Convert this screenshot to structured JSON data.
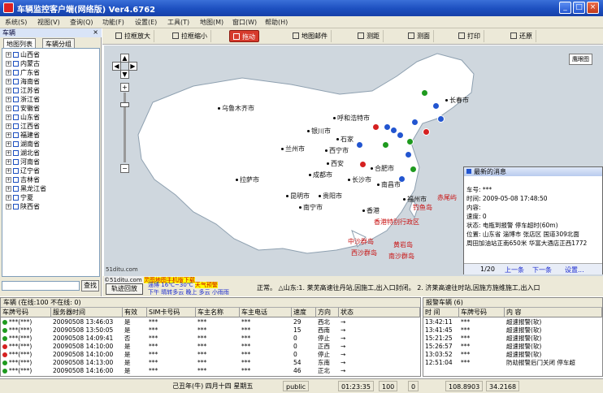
{
  "window": {
    "title": "车辆监控客户端(网络版) Ver4.6762",
    "minimize": "_",
    "maximize": "□",
    "close": "×"
  },
  "menu": [
    "系统(S)",
    "视图(V)",
    "查询(Q)",
    "功能(F)",
    "设置(E)",
    "工具(T)",
    "地图(M)",
    "窗口(W)",
    "帮助(H)"
  ],
  "left_panel": {
    "title": "车辆",
    "close": "×",
    "tabs": [
      "地图列表",
      "车辆分组"
    ],
    "provinces": [
      "山西省",
      "内蒙古",
      "广东省",
      "海南省",
      "江苏省",
      "浙江省",
      "安徽省",
      "山东省",
      "江西省",
      "福建省",
      "湖南省",
      "湖北省",
      "河南省",
      "辽宁省",
      "吉林省",
      "黑龙江省",
      "宁夏",
      "陕西省"
    ],
    "search_button": "查找"
  },
  "toolbar": {
    "zoom_in": "拉框放大",
    "zoom_out": "拉框缩小",
    "pan": "拖动",
    "map_info": "地图邮件",
    "distance": "测距",
    "area": "测面",
    "print": "打印",
    "restore": "还原"
  },
  "map": {
    "eagle_eye": "鹰眼图",
    "scale": "51ditu.com",
    "cities": [
      {
        "name": "乌鲁木齐市"
      },
      {
        "name": "呼和浩特市"
      },
      {
        "name": "银川市"
      },
      {
        "name": "兰州市"
      },
      {
        "name": "西宁市"
      },
      {
        "name": "拉萨市"
      },
      {
        "name": "成都市"
      },
      {
        "name": "昆明市"
      },
      {
        "name": "贵阳市"
      },
      {
        "name": "南宁市"
      },
      {
        "name": "长沙市"
      },
      {
        "name": "合肥市"
      },
      {
        "name": "南昌市"
      },
      {
        "name": "香港"
      },
      {
        "name": "福州市"
      },
      {
        "name": "石家"
      },
      {
        "name": "长春市"
      },
      {
        "name": "西安"
      }
    ],
    "red_labels": [
      "赤尾屿",
      "钓鱼岛",
      "中沙群岛",
      "西沙群岛",
      "黄岩岛",
      "南沙群岛",
      "香港特别行政区"
    ],
    "message": {
      "title": "最新的消息",
      "lines": [
        "车号: ***",
        "时间: 2009-05-08 17:48:50",
        "内容:",
        "速度: 0",
        "状态: 电瓶到报警 停车超时(60m)",
        "位置: 山东省 淄博市 张店区 国道309北面",
        "周田加油站正南650米 华富大酒店正西1772"
      ],
      "page": "1/20",
      "prev": "上一条",
      "next": "下一条",
      "settings": "设置..."
    }
  },
  "map_bar": {
    "copyright": "©51ditu.com",
    "copyright_note": "灵图地图手机版下载",
    "replay_button": "轨迹回放",
    "weather_city": "淄博",
    "weather_temp": "16℃~30℃",
    "weather_alert": "天气预警",
    "weather_desc": "下午 晴转多云 晚上 多云 小雨雨",
    "ticker": "正常。 △山东:1. 莱芜高速往丹站,因施工,出入口封闭。 2. 济莱高速往时站,因施方施维施工,出入口"
  },
  "vehicles_panel": {
    "title": "车辆    (在线:100  不在线: 0)",
    "columns": [
      "车牌号码",
      "服务器时间",
      "有效",
      "SIM卡号码",
      "车主名称",
      "车主电话",
      "速度",
      "方向",
      "状态"
    ],
    "rows": [
      {
        "status_color": "#1e9a1e",
        "plate": "***(***)",
        "time": "20090508 13:46:03",
        "valid": "是",
        "sim": "***",
        "owner": "***",
        "phone": "***",
        "speed": "29",
        "dir": "西北",
        "state": "→"
      },
      {
        "status_color": "#1e9a1e",
        "plate": "***(***)",
        "time": "20090508 13:50:05",
        "valid": "是",
        "sim": "***",
        "owner": "***",
        "phone": "***",
        "speed": "15",
        "dir": "西南",
        "state": "→"
      },
      {
        "status_color": "#1e9a1e",
        "plate": "***(***)",
        "time": "20090508 14:09:41",
        "valid": "否",
        "sim": "***",
        "owner": "***",
        "phone": "***",
        "speed": "0",
        "dir": "停止",
        "state": "→"
      },
      {
        "status_color": "#d52020",
        "plate": "***(***)",
        "time": "20090508 14:10:00",
        "valid": "是",
        "sim": "***",
        "owner": "***",
        "phone": "***",
        "speed": "0",
        "dir": "正西",
        "state": "→"
      },
      {
        "status_color": "#d52020",
        "plate": "***(***)",
        "time": "20090508 14:10:00",
        "valid": "是",
        "sim": "***",
        "owner": "***",
        "phone": "***",
        "speed": "0",
        "dir": "停止",
        "state": "→"
      },
      {
        "status_color": "#1e9a1e",
        "plate": "***(***)",
        "time": "20090508 14:13:00",
        "valid": "是",
        "sim": "***",
        "owner": "***",
        "phone": "***",
        "speed": "54",
        "dir": "东南",
        "state": "→"
      },
      {
        "status_color": "#1e9a1e",
        "plate": "***(***)",
        "time": "20090508 14:16:00",
        "valid": "是",
        "sim": "***",
        "owner": "***",
        "phone": "***",
        "speed": "46",
        "dir": "正北",
        "state": "→"
      }
    ]
  },
  "alarm_panel": {
    "title": "报警车辆  (6)",
    "columns": [
      "时 间",
      "车牌号码",
      "内 容"
    ],
    "rows": [
      {
        "time": "13:42:11",
        "plate": "***",
        "content": "超速报警(软)"
      },
      {
        "time": "13:41:45",
        "plate": "***",
        "content": "超速报警(软)"
      },
      {
        "time": "15:21:25",
        "plate": "***",
        "content": "超速报警(软)"
      },
      {
        "time": "15:26:57",
        "plate": "***",
        "content": "超速报警(软)"
      },
      {
        "time": "13:03:52",
        "plate": "***",
        "content": "超速报警(软)"
      },
      {
        "time": "12:51:04",
        "plate": "***",
        "content": "防劫报警后门关闭 停车超"
      }
    ]
  },
  "statusbar": {
    "date": "己丑年(牛) 四月十四 星期五",
    "user": "public",
    "clock": "01:23:35",
    "counter": "100",
    "zero": "0",
    "lon": "108.8903",
    "lat": "34.2168"
  }
}
